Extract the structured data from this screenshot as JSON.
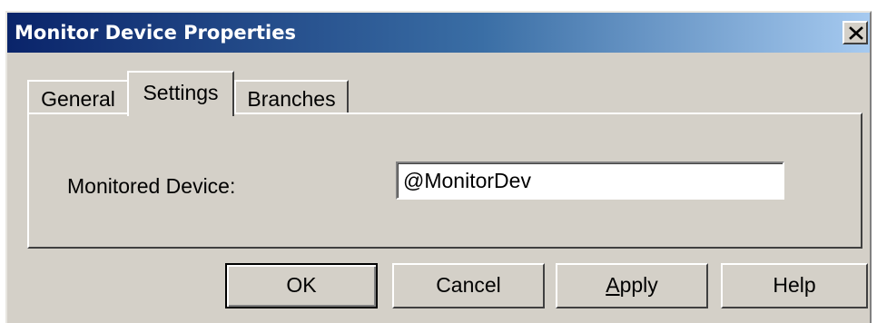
{
  "window": {
    "title": "Monitor Device Properties",
    "close_icon": "close-icon"
  },
  "tabs": [
    {
      "label": "General",
      "selected": false
    },
    {
      "label": "Settings",
      "selected": true
    },
    {
      "label": "Branches",
      "selected": false
    }
  ],
  "settings": {
    "monitored_device_label": "Monitored Device:",
    "monitored_device_value": "@MonitorDev"
  },
  "buttons": {
    "ok": "OK",
    "cancel": "Cancel",
    "apply_first": "A",
    "apply_rest": "pply",
    "help": "Help"
  },
  "colors": {
    "title_gradient_start": "#0a246a",
    "title_gradient_end": "#a6caf0",
    "face": "#d4d0c8"
  }
}
